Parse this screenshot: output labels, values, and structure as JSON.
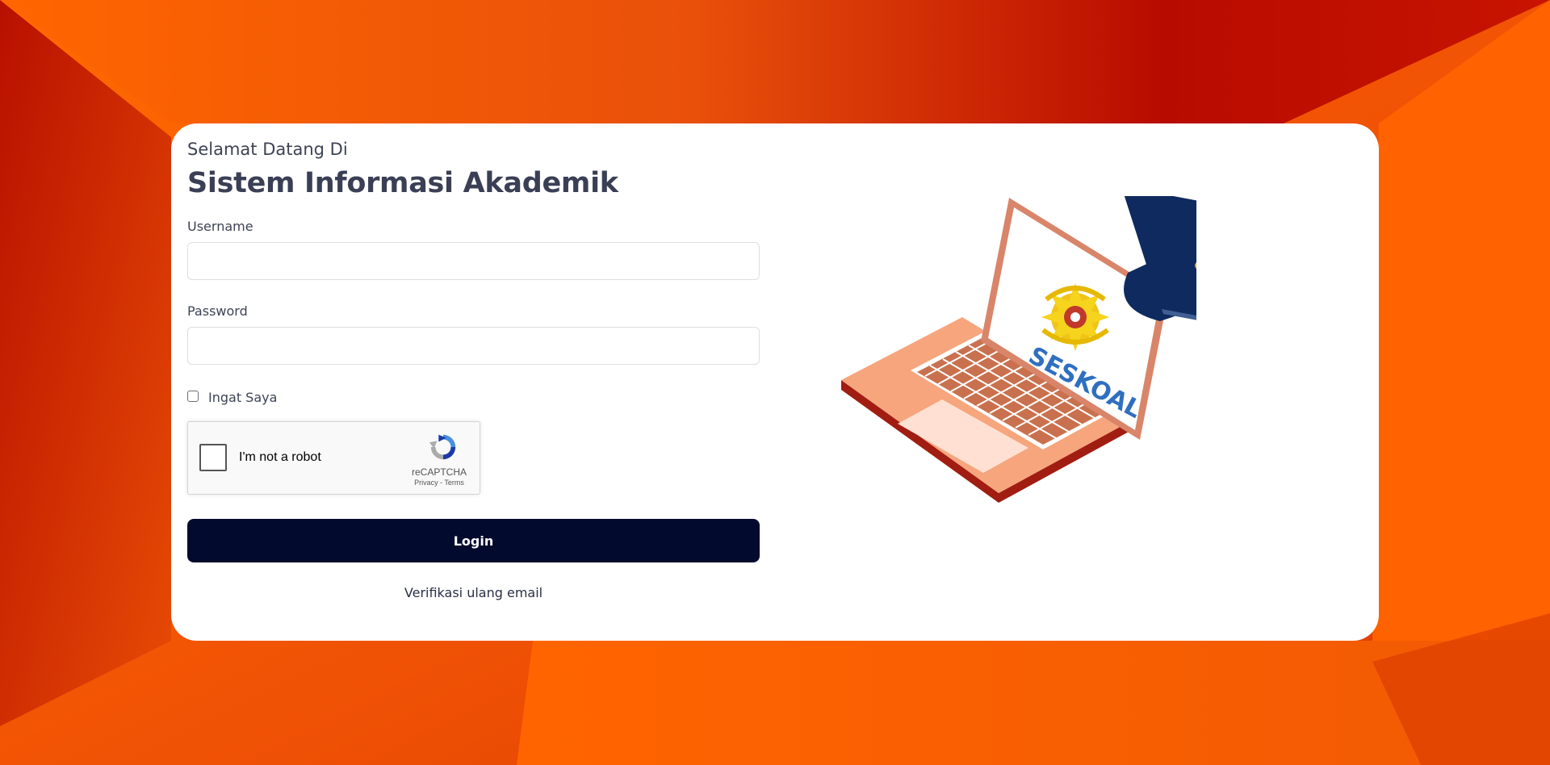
{
  "login": {
    "greeting": "Selamat Datang Di",
    "title": "Sistem Informasi Akademik",
    "username_label": "Username",
    "username_value": "",
    "password_label": "Password",
    "password_value": "",
    "remember_label": "Ingat Saya",
    "remember_checked": false,
    "login_label": "Login",
    "verify_link": "Verifikasi ulang email"
  },
  "recaptcha": {
    "checkbox_label": "I'm not a robot",
    "brand": "reCAPTCHA",
    "links": "Privacy - Terms"
  },
  "illustration": {
    "logo_text": "SESKOAL"
  },
  "colors": {
    "background_primary": "#ff5e00",
    "background_dark": "#b30a00",
    "button": "#020b2d",
    "mortarboard": "#0f2a5e",
    "laptop": "#f4a57e"
  }
}
